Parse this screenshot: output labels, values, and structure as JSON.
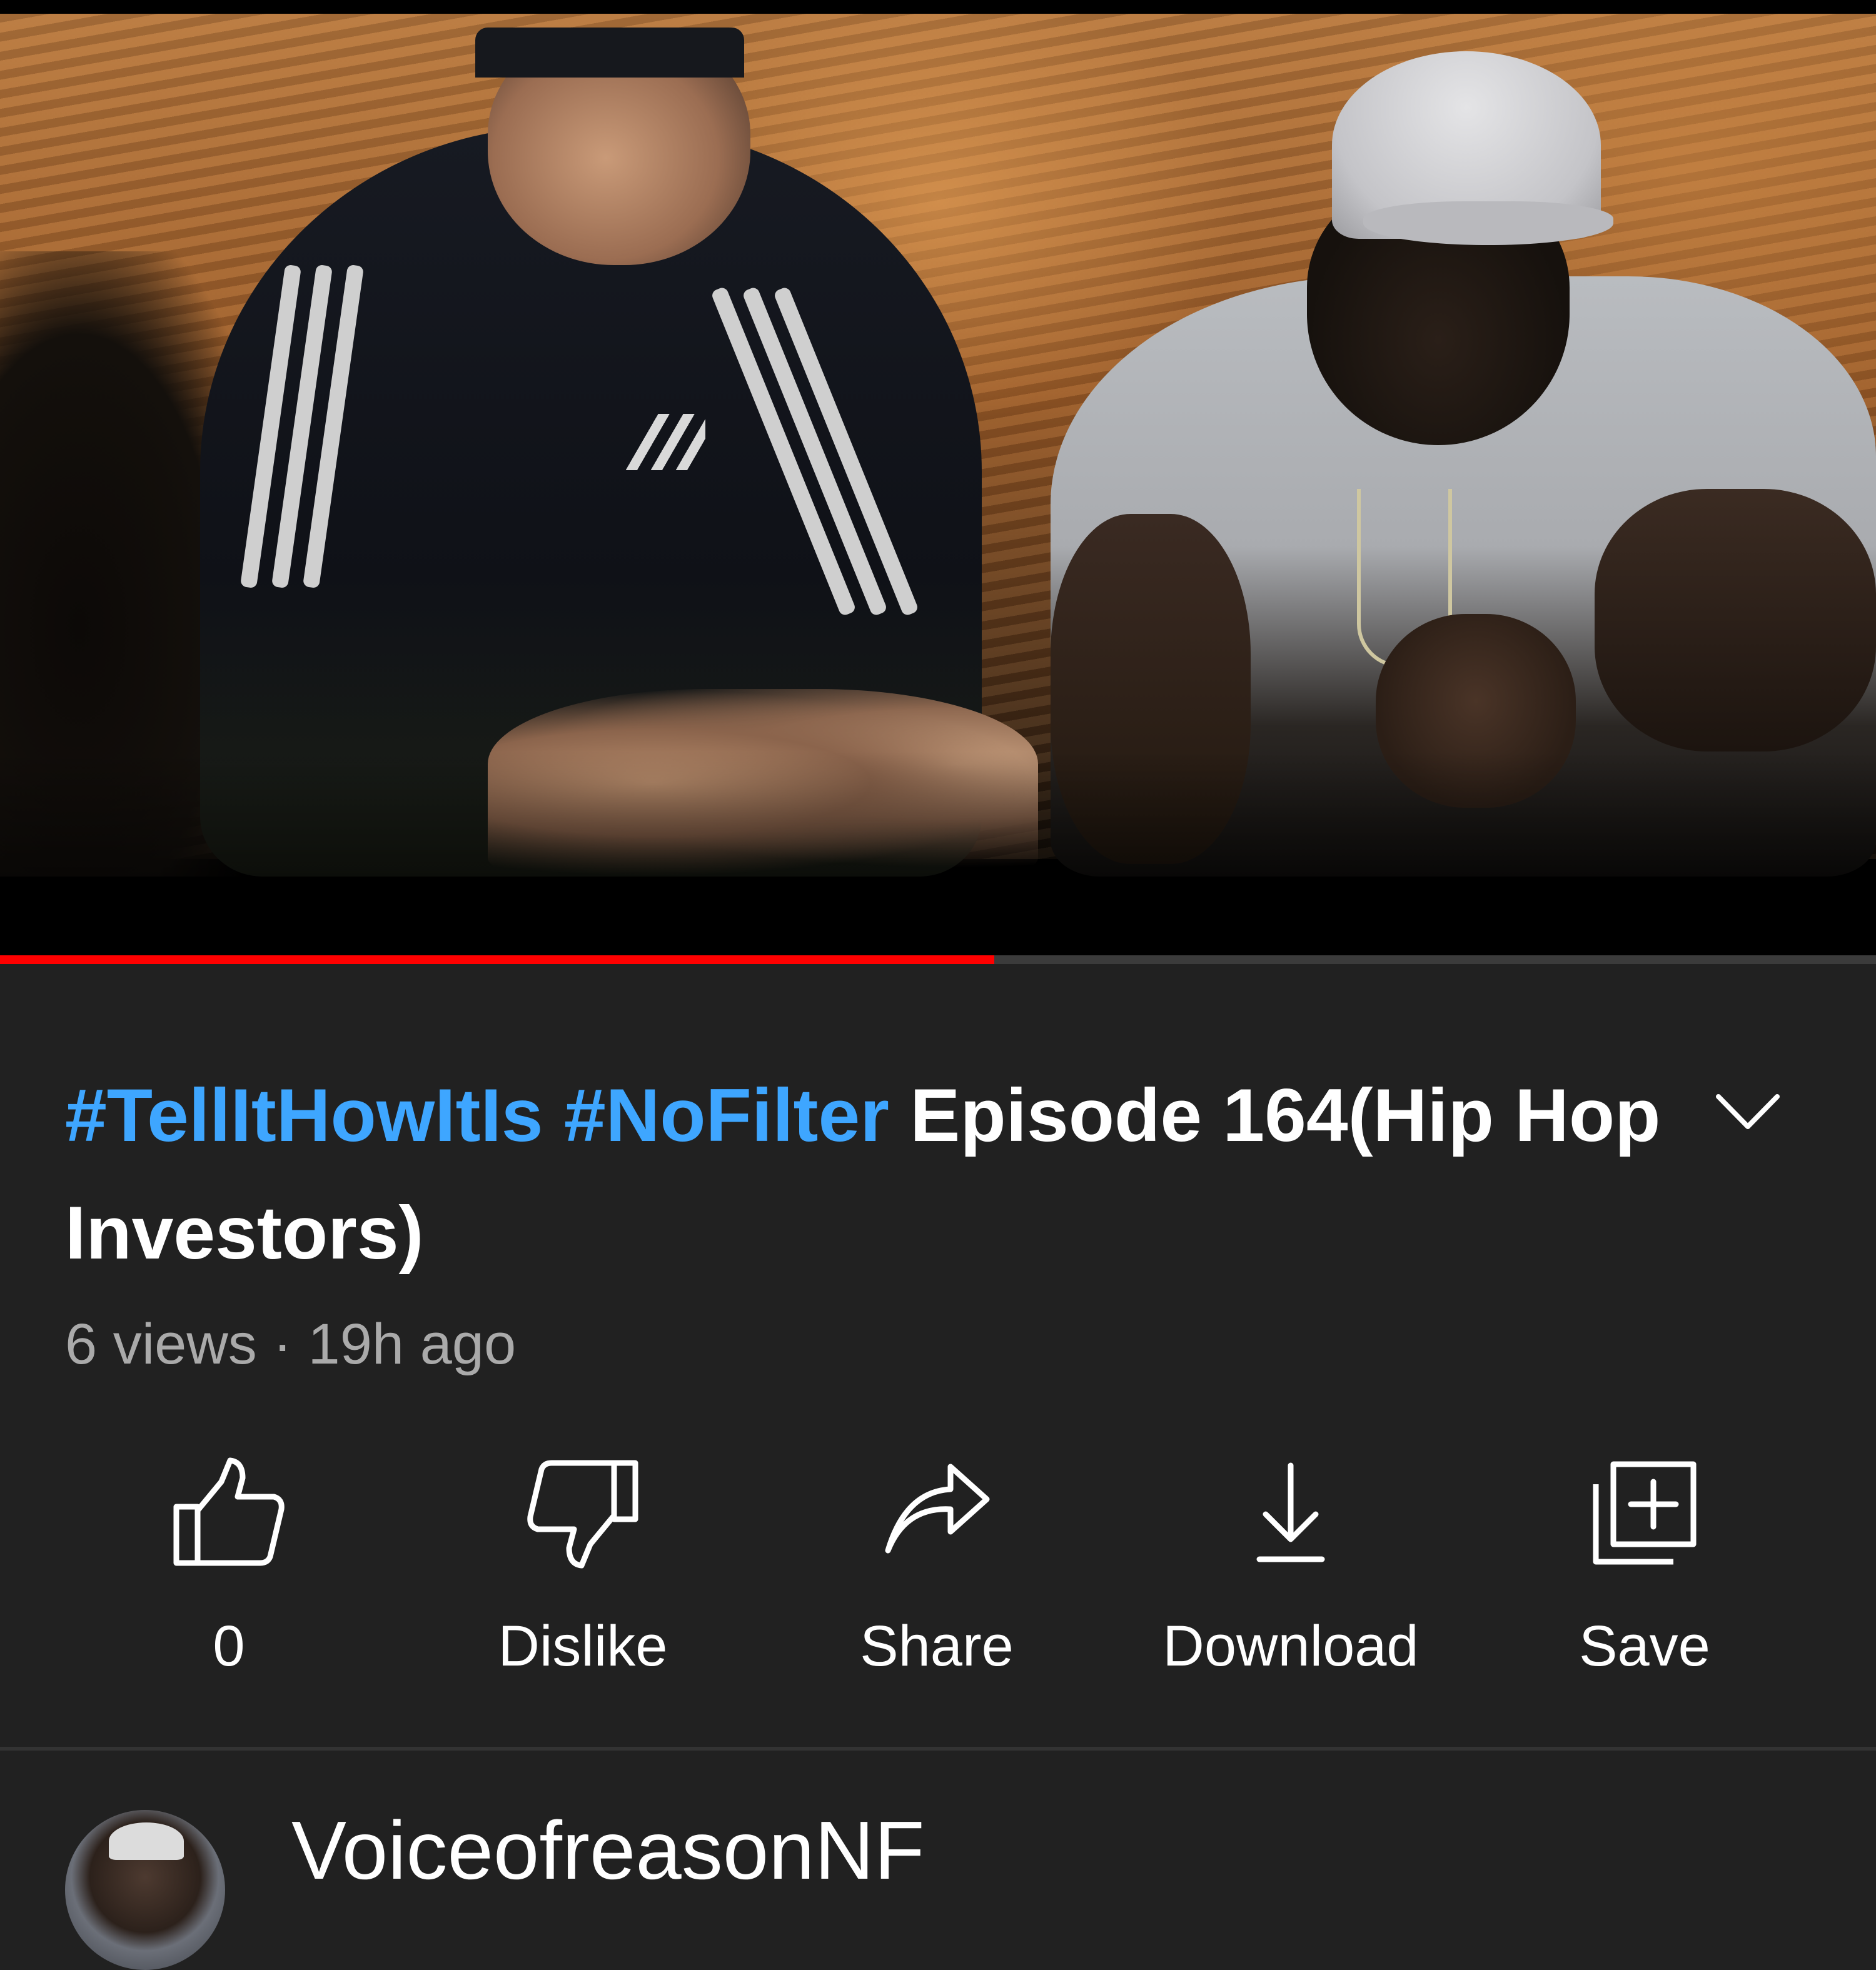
{
  "player": {
    "progress_fraction": 0.53,
    "progress_color": "#ff0000"
  },
  "video": {
    "title_hashtags": [
      "#TellItHowItIs",
      "#NoFilter"
    ],
    "title_text": "Episode 164(Hip Hop Investors)",
    "views": "6 views",
    "separator": "·",
    "age": "19h ago"
  },
  "actions": [
    {
      "name": "like",
      "label": "0",
      "icon": "thumbs-up-icon"
    },
    {
      "name": "dislike",
      "label": "Dislike",
      "icon": "thumbs-down-icon"
    },
    {
      "name": "share",
      "label": "Share",
      "icon": "share-arrow-icon"
    },
    {
      "name": "download",
      "label": "Download",
      "icon": "download-icon"
    },
    {
      "name": "save",
      "label": "Save",
      "icon": "add-to-playlist-icon"
    }
  ],
  "channel": {
    "name": "VoiceofreasonNF"
  },
  "colors": {
    "background": "#212121",
    "hashtag": "#3ea6ff",
    "text": "#ffffff",
    "meta": "#aaaaaa"
  }
}
